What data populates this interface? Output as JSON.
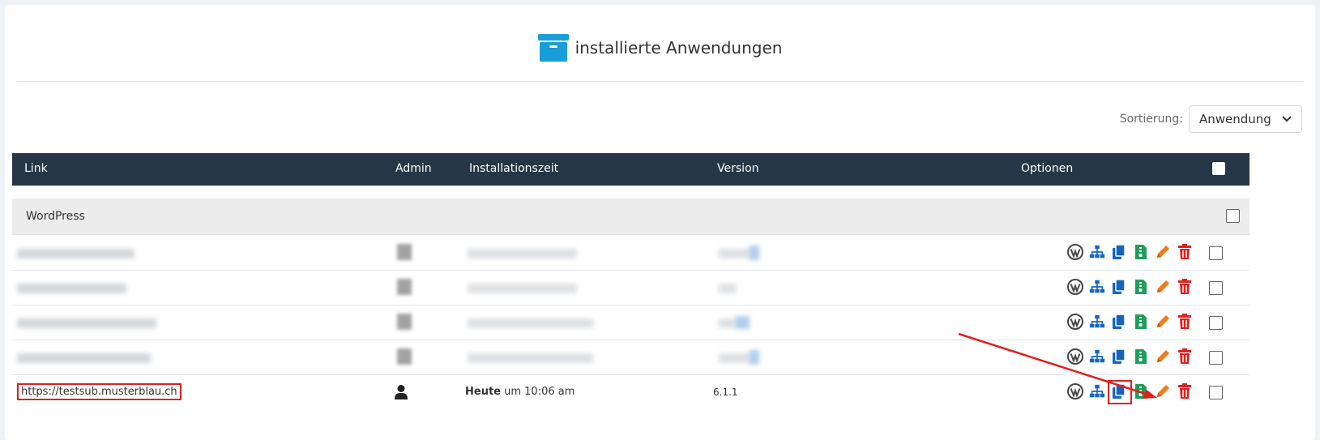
{
  "page": {
    "title": "installierte Anwendungen",
    "title_icon": "archive-box-icon",
    "accent": "#1a9ed9"
  },
  "sort": {
    "label": "Sortierung:",
    "selected": "Anwendung"
  },
  "table": {
    "columns": [
      "Link",
      "Admin",
      "Installationszeit",
      "Version",
      "Optionen"
    ],
    "group": "WordPress",
    "highlighted_row": {
      "link": "https://testsub.musterblau.ch",
      "time_bold": "Heute",
      "time_rest": " um 10:06 am",
      "version": "6.1.1"
    },
    "option_icons": [
      "wordpress-icon",
      "sitemap-icon",
      "copy-icon",
      "archive-file-icon",
      "edit-pencil-icon",
      "trash-icon"
    ]
  },
  "colors": {
    "header_bg": "#253746",
    "wordpress": "#464646",
    "blue": "#1565c0",
    "green": "#1e9e5a",
    "orange": "#f07c1a",
    "red": "#e02020"
  }
}
